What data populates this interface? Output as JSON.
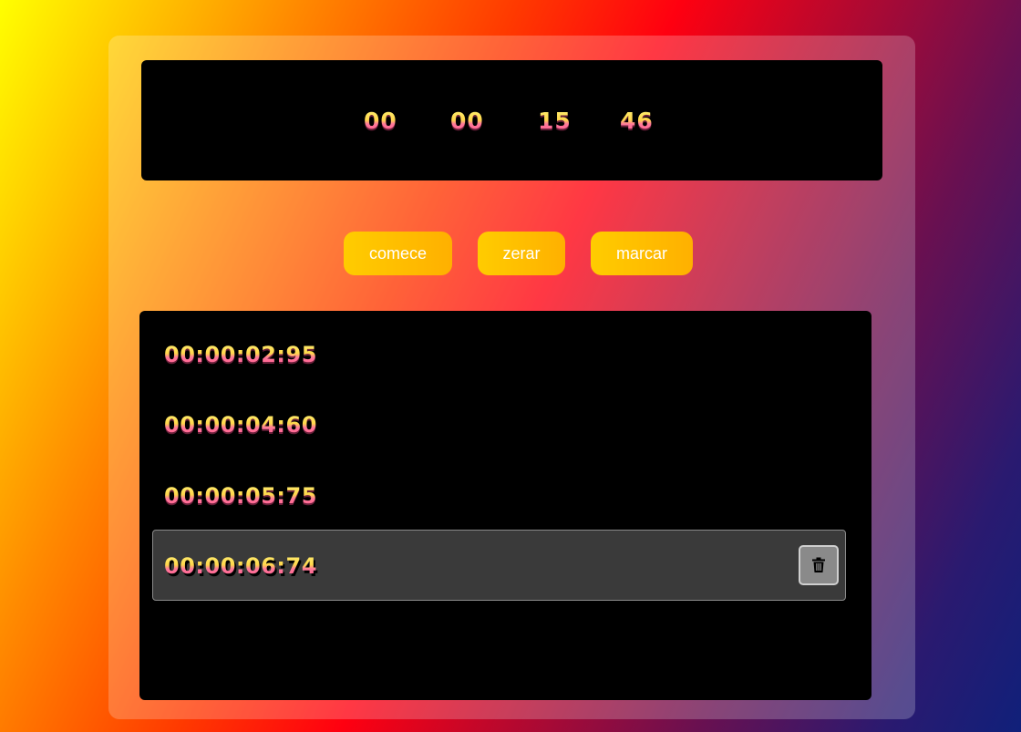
{
  "timer": {
    "hours": "00",
    "minutes": "00",
    "seconds": "15",
    "centiseconds": "46"
  },
  "controls": {
    "start_label": "comece",
    "reset_label": "zerar",
    "mark_label": "marcar"
  },
  "laps": [
    {
      "time": "00:00:02:95"
    },
    {
      "time": "00:00:04:60"
    },
    {
      "time": "00:00:05:75"
    },
    {
      "time": "00:00:06:74"
    }
  ],
  "icons": {
    "delete": "trash-icon"
  },
  "colors": {
    "button_start": "#ffcc00",
    "button_end": "#ffb000",
    "digit_top": "#fff27a",
    "digit_bottom": "#ff4f8c",
    "panel": "#000000",
    "active_row": "#3a3a3a"
  }
}
